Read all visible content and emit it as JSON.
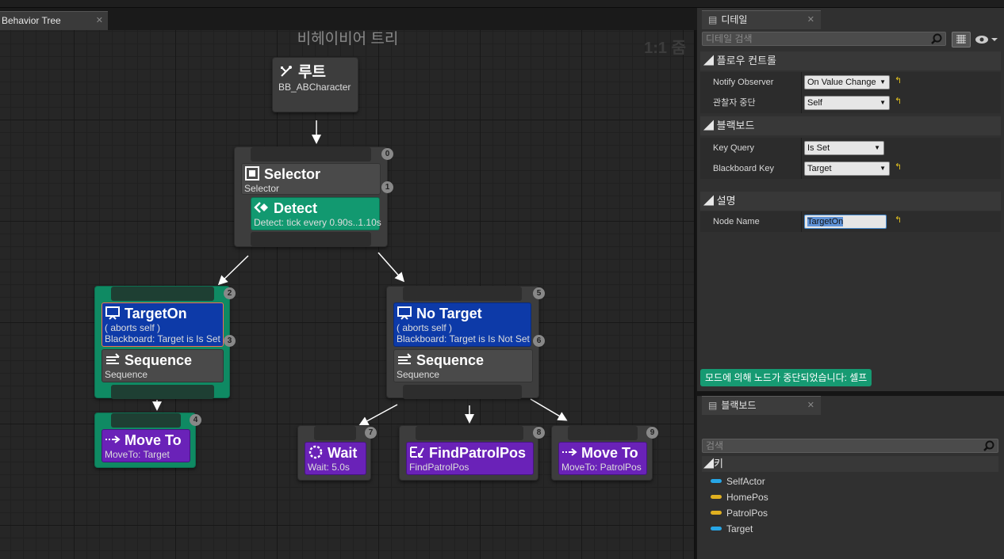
{
  "colors": {
    "accent": "#0f8a63",
    "decorator": "#0d3aa8",
    "task": "#6a22b8",
    "service": "#129970",
    "key_object": "#27a6e6",
    "key_vector": "#e0b020"
  },
  "doc_tab": {
    "label": "Behavior Tree",
    "close": "✕"
  },
  "graph": {
    "title": "비헤이비어 트리",
    "zoom": "1:1 줌"
  },
  "root": {
    "title": "루트",
    "sub": "BB_ABCharacter"
  },
  "selector": {
    "title": "Selector",
    "sub": "Selector",
    "badge_top": "0",
    "badge_side": "1"
  },
  "detect": {
    "title": "Detect",
    "sub": "Detect: tick every 0.90s..1.10s"
  },
  "left_branch": {
    "badge_top": "2",
    "badge_side": "3",
    "decorator": {
      "title": "TargetOn",
      "line1": "( aborts self )",
      "line2": "Blackboard: Target is Is Set"
    },
    "sequence": {
      "title": "Sequence",
      "sub": "Sequence"
    }
  },
  "right_branch": {
    "badge_top": "5",
    "badge_side": "6",
    "decorator": {
      "title": "No Target",
      "line1": "( aborts self )",
      "line2": "Blackboard: Target is Is Not Set"
    },
    "sequence": {
      "title": "Sequence",
      "sub": "Sequence"
    }
  },
  "tasks": {
    "moveto_target": {
      "title": "Move To",
      "sub": "MoveTo: Target",
      "badge": "4"
    },
    "wait": {
      "title": "Wait",
      "sub": "Wait: 5.0s",
      "badge": "7"
    },
    "findpatrol": {
      "title": "FindPatrolPos",
      "sub": "FindPatrolPos",
      "badge": "8"
    },
    "moveto_patrol": {
      "title": "Move To",
      "sub": "MoveTo: PatrolPos",
      "badge": "9"
    }
  },
  "details": {
    "tab_label": "디테일",
    "search_placeholder": "디테일 검색",
    "categories": {
      "flow": "플로우 컨트롤",
      "blackboard": "블랙보드",
      "description": "설명"
    },
    "rows": {
      "notify_label": "Notify Observer",
      "notify_value": "On Value Change",
      "abort_label": "관찰자 중단",
      "abort_value": "Self",
      "keyquery_label": "Key Query",
      "keyquery_value": "Is Set",
      "bbkey_label": "Blackboard Key",
      "bbkey_value": "Target",
      "nodename_label": "Node Name",
      "nodename_value": "TargetOn"
    },
    "toast": "모드에 의해 노드가 중단되었습니다: 셀프"
  },
  "blackboard": {
    "tab_label": "블랙보드",
    "search_placeholder": "검색",
    "section": "키",
    "keys": [
      {
        "name": "SelfActor",
        "color": "#27a6e6"
      },
      {
        "name": "HomePos",
        "color": "#e0b020"
      },
      {
        "name": "PatrolPos",
        "color": "#e0b020"
      },
      {
        "name": "Target",
        "color": "#27a6e6"
      }
    ]
  }
}
